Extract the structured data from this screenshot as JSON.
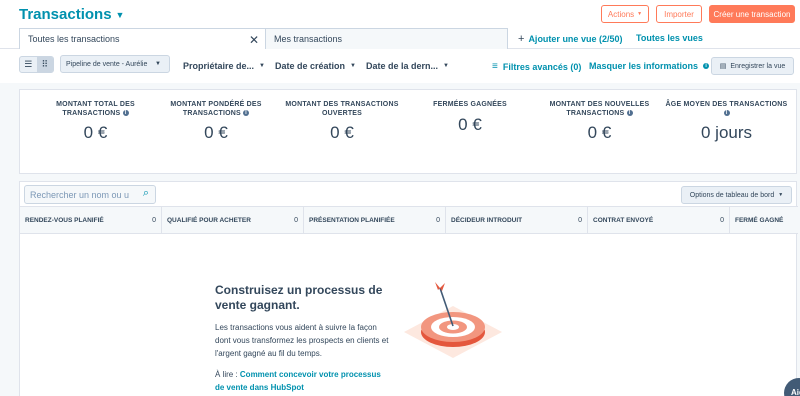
{
  "header": {
    "title": "Transactions",
    "actions_label": "Actions",
    "import_label": "Importer",
    "create_label": "Créer une transaction"
  },
  "tabs": [
    {
      "label": "Toutes les transactions"
    },
    {
      "label": "Mes transactions"
    }
  ],
  "views": {
    "add_view_label": "Ajouter une vue (2/50)",
    "all_views_label": "Toutes les vues"
  },
  "filters": {
    "pipeline_label": "Pipeline de vente - Aurélie",
    "owner_label": "Propriétaire de...",
    "created_label": "Date de création",
    "last_label": "Date de la dern...",
    "advanced_label": "Filtres avancés (0)",
    "hide_label": "Masquer les informations",
    "save_view_label": "Enregistrer la vue"
  },
  "stats": [
    {
      "label": "Montant total des transactions",
      "value": "0 €"
    },
    {
      "label": "Montant pondéré des transactions",
      "value": "0 €"
    },
    {
      "label": "Montant des transactions ouvertes",
      "value": "0 €"
    },
    {
      "label": "Fermées gagnées",
      "value": "0 €"
    },
    {
      "label": "Montant des nouvelles transactions",
      "value": "0 €"
    },
    {
      "label": "Âge moyen des transactions",
      "value": "0 jours"
    }
  ],
  "board": {
    "search_placeholder": "Rechercher un nom ou u",
    "options_label": "Options de tableau de bord",
    "columns": [
      {
        "label": "RENDEZ-VOUS PLANIFIÉ",
        "count": "0"
      },
      {
        "label": "QUALIFIÉ POUR ACHETER",
        "count": "0"
      },
      {
        "label": "PRÉSENTATION PLANIFIÉE",
        "count": "0"
      },
      {
        "label": "DÉCIDEUR INTRODUIT",
        "count": "0"
      },
      {
        "label": "CONTRAT ENVOYÉ",
        "count": "0"
      },
      {
        "label": "FERMÉ GAGNÉ",
        "count": ""
      }
    ]
  },
  "empty_state": {
    "title": "Construisez un processus de vente gagnant.",
    "text": "Les transactions vous aident à suivre la façon dont vous transformez les prospects en clients et l'argent gagné au fil du temps.",
    "read_prefix": "À lire : ",
    "read_link": "Comment concevoir votre processus de vente dans HubSpot"
  },
  "chat_label": "Aid"
}
